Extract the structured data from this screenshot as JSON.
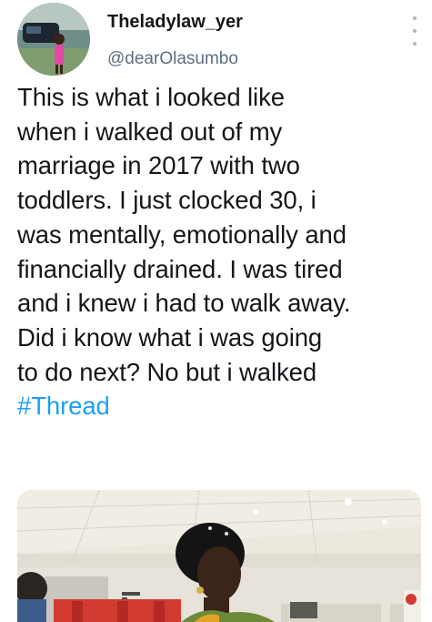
{
  "author": {
    "display_name": "Theladylaw_yer",
    "handle": "@dearOlasumbo",
    "avatar_icon": "profile-photo"
  },
  "menu": {
    "icon": "more-vertical-icon"
  },
  "tweet": {
    "lines": [
      "This is what i looked like",
      "when i walked out of my",
      "marriage in 2017 with two",
      "toddlers. I just clocked 30, i",
      "was mentally, emotionally and",
      "financially drained. I was tired",
      "and i knew i had to walk away.",
      "Did i know what i was going",
      "to do next? No but i walked"
    ],
    "hashtag": "#Thread"
  },
  "media": {
    "type": "photo"
  },
  "colors": {
    "text": "#14171a",
    "secondary": "#5b7083",
    "link": "#1da1f2"
  }
}
